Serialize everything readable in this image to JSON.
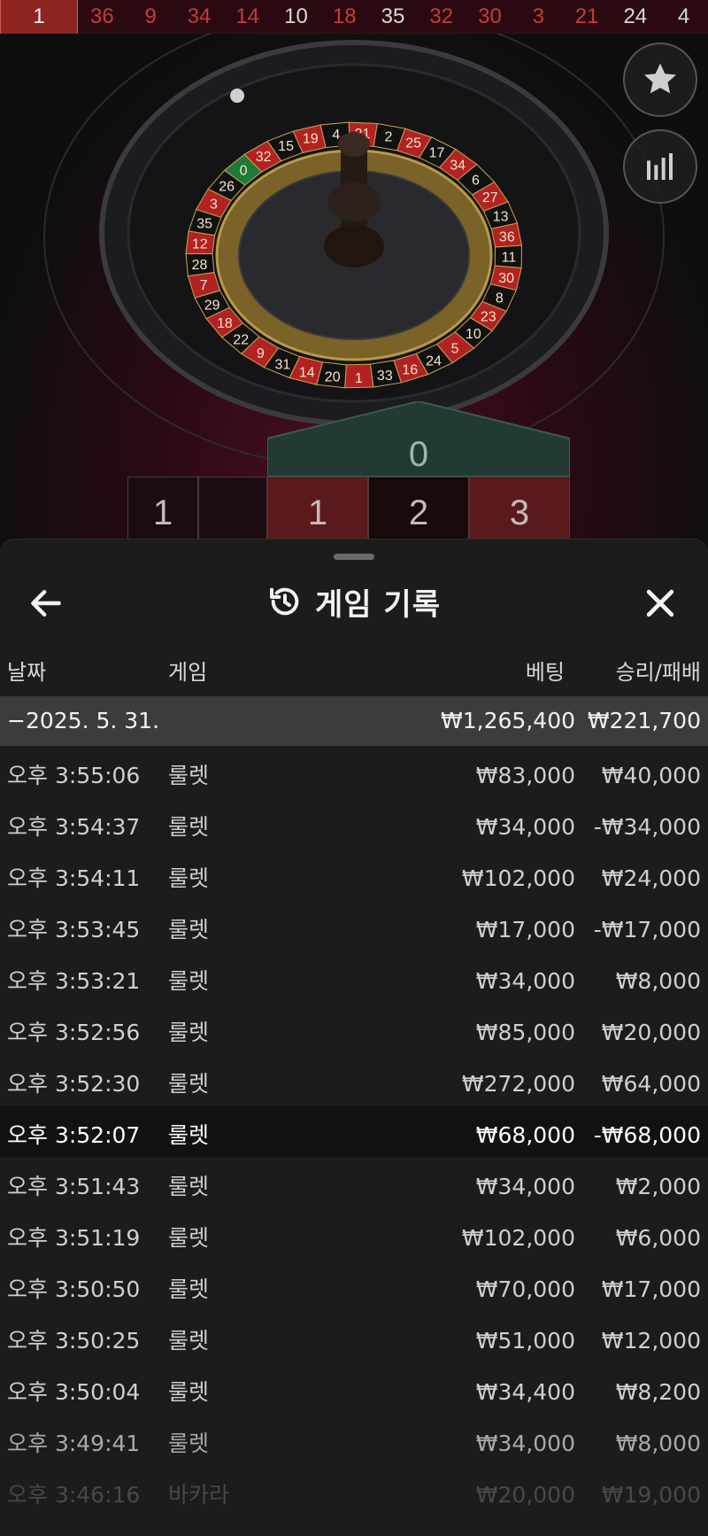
{
  "results": [
    {
      "n": "1",
      "c": "red"
    },
    {
      "n": "36",
      "c": "red"
    },
    {
      "n": "9",
      "c": "red"
    },
    {
      "n": "34",
      "c": "red"
    },
    {
      "n": "14",
      "c": "red"
    },
    {
      "n": "10",
      "c": "black"
    },
    {
      "n": "18",
      "c": "red"
    },
    {
      "n": "35",
      "c": "black"
    },
    {
      "n": "32",
      "c": "red"
    },
    {
      "n": "30",
      "c": "red"
    },
    {
      "n": "3",
      "c": "red"
    },
    {
      "n": "21",
      "c": "red"
    },
    {
      "n": "24",
      "c": "black"
    },
    {
      "n": "4",
      "c": "black"
    }
  ],
  "wheel": {
    "numbers": [
      "0",
      "32",
      "15",
      "19",
      "4",
      "21",
      "2",
      "25",
      "17",
      "34",
      "6",
      "27",
      "13",
      "36",
      "11",
      "30",
      "8",
      "23",
      "10",
      "5",
      "24",
      "16",
      "33",
      "1",
      "20",
      "14",
      "31",
      "9",
      "22",
      "18",
      "29",
      "7",
      "28",
      "12",
      "35",
      "3",
      "26"
    ]
  },
  "betting": {
    "zero": "0",
    "c1": "1",
    "c2": "2",
    "c3": "3",
    "edge": "1"
  },
  "sheet": {
    "title": "게임 기록",
    "columns": {
      "date": "날짜",
      "game": "게임",
      "bet": "베팅",
      "win": "승리/패배"
    },
    "day": {
      "date": "−2025. 5. 31.",
      "bet": "₩1,265,400",
      "win": "₩221,700"
    },
    "rows": [
      {
        "time": "오후 3:55:06",
        "game": "룰렛",
        "bet": "₩83,000",
        "win": "₩40,000"
      },
      {
        "time": "오후 3:54:37",
        "game": "룰렛",
        "bet": "₩34,000",
        "win": "-₩34,000"
      },
      {
        "time": "오후 3:54:11",
        "game": "룰렛",
        "bet": "₩102,000",
        "win": "₩24,000"
      },
      {
        "time": "오후 3:53:45",
        "game": "룰렛",
        "bet": "₩17,000",
        "win": "-₩17,000"
      },
      {
        "time": "오후 3:53:21",
        "game": "룰렛",
        "bet": "₩34,000",
        "win": "₩8,000"
      },
      {
        "time": "오후 3:52:56",
        "game": "룰렛",
        "bet": "₩85,000",
        "win": "₩20,000"
      },
      {
        "time": "오후 3:52:30",
        "game": "룰렛",
        "bet": "₩272,000",
        "win": "₩64,000"
      },
      {
        "time": "오후 3:52:07",
        "game": "룰렛",
        "bet": "₩68,000",
        "win": "-₩68,000"
      },
      {
        "time": "오후 3:51:43",
        "game": "룰렛",
        "bet": "₩34,000",
        "win": "₩2,000"
      },
      {
        "time": "오후 3:51:19",
        "game": "룰렛",
        "bet": "₩102,000",
        "win": "₩6,000"
      },
      {
        "time": "오후 3:50:50",
        "game": "룰렛",
        "bet": "₩70,000",
        "win": "₩17,000"
      },
      {
        "time": "오후 3:50:25",
        "game": "룰렛",
        "bet": "₩51,000",
        "win": "₩12,000"
      },
      {
        "time": "오후 3:50:04",
        "game": "룰렛",
        "bet": "₩34,400",
        "win": "₩8,200"
      },
      {
        "time": "오후 3:49:41",
        "game": "룰렛",
        "bet": "₩34,000",
        "win": "₩8,000"
      },
      {
        "time": "오후 3:46:16",
        "game": "바카라",
        "bet": "₩20,000",
        "win": "₩19,000"
      }
    ]
  },
  "icons": {
    "favorite": "star-icon",
    "stats": "bar-chart-icon",
    "history": "history-icon",
    "back": "arrow-left-icon",
    "close": "close-icon"
  },
  "colors": {
    "red": "#c83a3a",
    "highlight_row": "#121212",
    "day_row": "#3c3c3c",
    "zero_green": "#223a34"
  }
}
